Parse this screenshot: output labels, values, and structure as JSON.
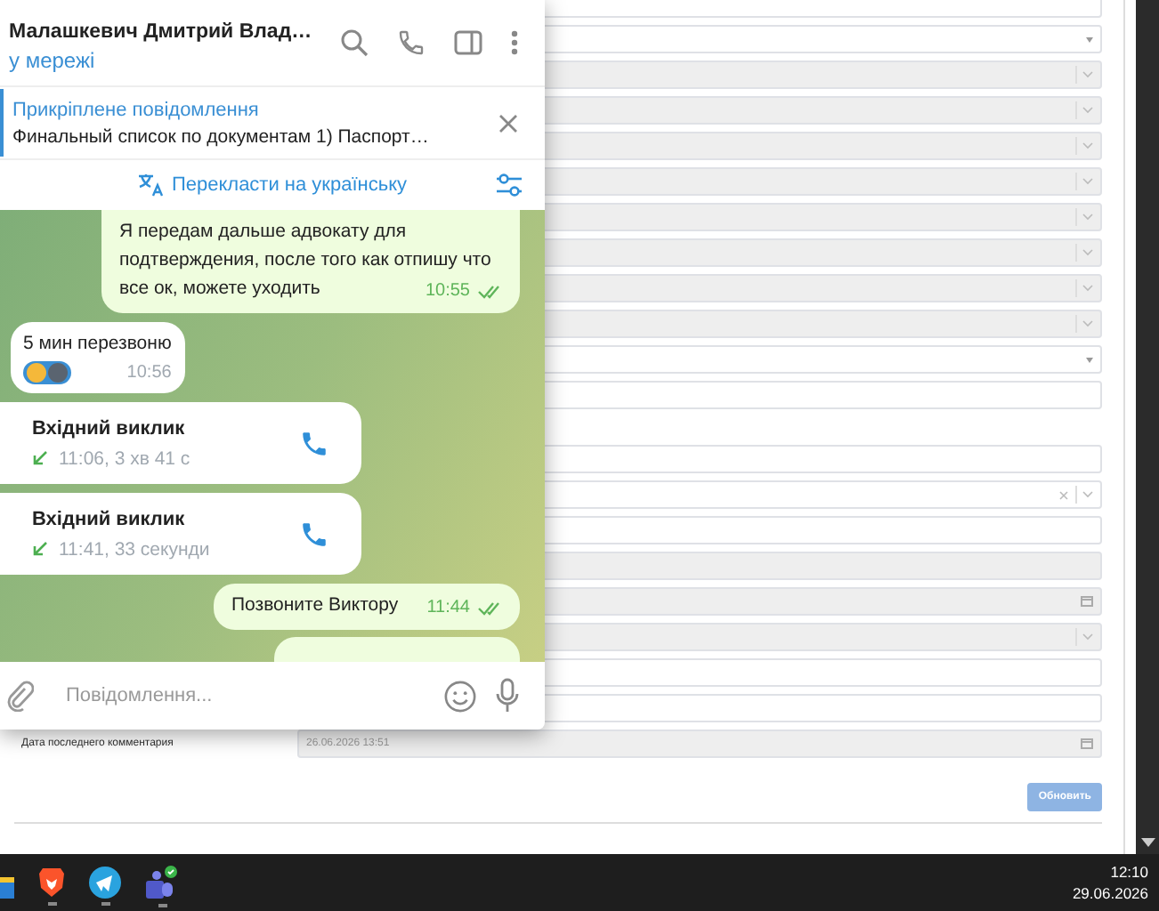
{
  "form": {
    "top_fields": [
      {
        "kind": "input"
      },
      {
        "kind": "select"
      },
      {
        "kind": "disabled-select"
      },
      {
        "kind": "disabled-select"
      },
      {
        "kind": "disabled-select"
      },
      {
        "kind": "disabled-select"
      },
      {
        "kind": "disabled-select"
      },
      {
        "kind": "disabled-select"
      },
      {
        "kind": "disabled-select"
      },
      {
        "kind": "disabled-select"
      },
      {
        "kind": "select"
      },
      {
        "kind": "input"
      }
    ],
    "bottom_fields": [
      {
        "kind": "input"
      },
      {
        "kind": "clear-select"
      },
      {
        "kind": "input"
      },
      {
        "kind": "disabled-input"
      },
      {
        "kind": "disabled-date"
      },
      {
        "kind": "disabled-select"
      },
      {
        "kind": "input"
      },
      {
        "kind": "input"
      },
      {
        "kind": "disabled-date",
        "label": "Дата последнего комментария",
        "value": "26.06.2026 13:51"
      }
    ],
    "submit_button": "Обновить"
  },
  "chat": {
    "contact_name": "Малашкевич Дмитрий Влад…",
    "status": "у мережі",
    "pinned": {
      "title": "Прикріплене повідомлення",
      "text": "Финальный список по документам  1) Паспорт…"
    },
    "translate": "Перекласти на українську",
    "messages": [
      {
        "kind": "out",
        "text": "Я передам дальше адвокату для подтверждения, после того как отпишу что все ок, можете уходить",
        "time": "10:55",
        "read": true
      },
      {
        "kind": "in",
        "text": "5 мин перезвоню",
        "time": "10:56",
        "reacted": true
      },
      {
        "kind": "call",
        "title": "Вхідний виклик",
        "detail": "11:06, 3 хв 41 с"
      },
      {
        "kind": "call",
        "title": "Вхідний виклик",
        "detail": "11:41, 33 секунди"
      },
      {
        "kind": "out",
        "text": "Позвоните Виктору",
        "time": "11:44",
        "read": true
      },
      {
        "kind": "partial"
      }
    ],
    "composer": {
      "placeholder": "Повідомлення..."
    }
  },
  "taskbar": {
    "time": "12:10",
    "date": "29.06.2026"
  }
}
